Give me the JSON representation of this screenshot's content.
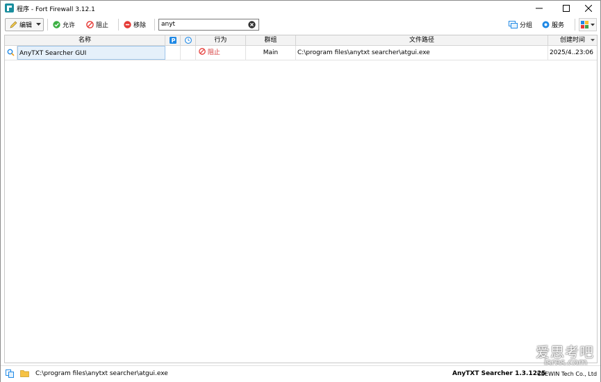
{
  "window": {
    "title": "程序 - Fort Firewall 3.12.1"
  },
  "toolbar": {
    "edit_label": "编辑",
    "allow_label": "允许",
    "block_label": "阻止",
    "remove_label": "移除",
    "search_value": "anyt",
    "group_label": "分组",
    "service_label": "服务"
  },
  "table": {
    "columns": {
      "name": "名称",
      "action": "行为",
      "group": "群组",
      "path": "文件路径",
      "created": "创建时间"
    },
    "rows": [
      {
        "name": "AnyTXT Searcher GUI",
        "action": "阻止",
        "group": "Main",
        "path": "C:\\program files\\anytxt searcher\\atgui.exe",
        "created_date": "2025/4...",
        "created_time": "23:06"
      }
    ]
  },
  "statusbar": {
    "path": "C:\\program files\\anytxt searcher\\atgui.exe",
    "product": "AnyTXT Searcher 1.3.1225",
    "company": "CBEWIN Tech Co., Ltd"
  },
  "watermark": {
    "line1": "爱思考吧",
    "line2": "isres.com"
  },
  "colors": {
    "allow": "#3cb043",
    "block": "#e53935",
    "remove": "#e53935",
    "selection": "#e5f0fa",
    "accent": "#1e88e5"
  }
}
